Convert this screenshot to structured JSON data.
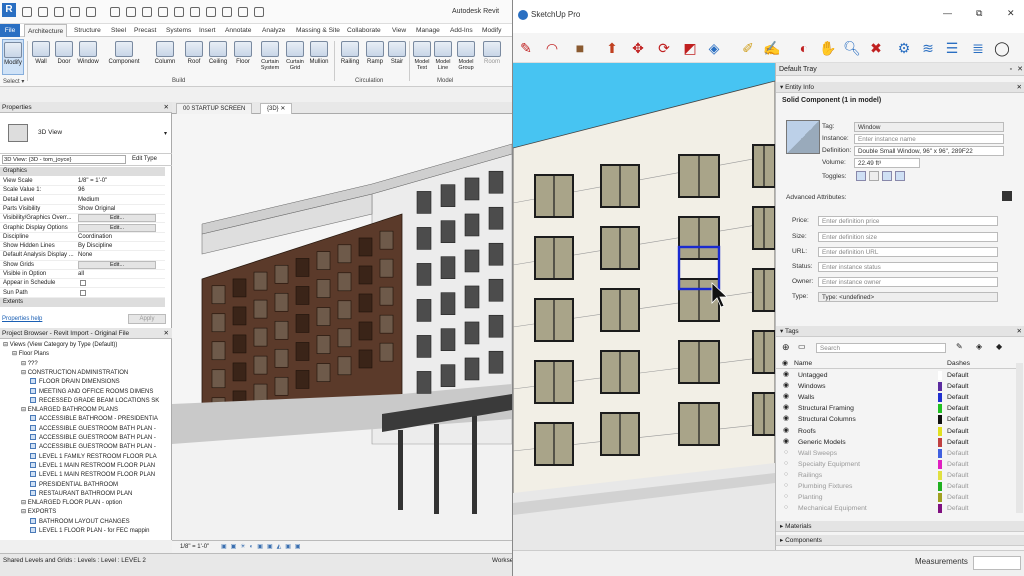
{
  "revit": {
    "title": "Autodesk Revit",
    "tabs": [
      "File",
      "Architecture",
      "Structure",
      "Steel",
      "Precast",
      "Systems",
      "Insert",
      "Annotate",
      "Analyze",
      "Massing & Site",
      "Collaborate",
      "View",
      "Manage",
      "Add-Ins",
      "Modify"
    ],
    "ribbon_tools": [
      "Modify",
      "Wall",
      "Door",
      "Window",
      "Component",
      "Column",
      "Roof",
      "Ceiling",
      "Floor",
      "Curtain System",
      "Curtain Grid",
      "Mullion",
      "Railing",
      "Ramp",
      "Stair",
      "Model Text",
      "Model Line",
      "Model Group",
      "Room"
    ],
    "ribbon_groups": {
      "select": "Select ▾",
      "build": "Build",
      "circulation": "Circulation",
      "model": "Model"
    },
    "properties": {
      "header": "Properties",
      "type_name": "3D View",
      "view_selector": "3D View: {3D - tom_joyce}",
      "edit_type": "Edit Type",
      "section_graphics": "Graphics",
      "rows": [
        {
          "k": "View Scale",
          "v": "1/8\" = 1'-0\""
        },
        {
          "k": "Scale Value    1:",
          "v": "96"
        },
        {
          "k": "Detail Level",
          "v": "Medium"
        },
        {
          "k": "Parts Visibility",
          "v": "Show Original"
        },
        {
          "k": "Visibility/Graphics Overr...",
          "v": "Edit..."
        },
        {
          "k": "Graphic Display Options",
          "v": "Edit..."
        },
        {
          "k": "Discipline",
          "v": "Coordination"
        },
        {
          "k": "Show Hidden Lines",
          "v": "By Discipline"
        },
        {
          "k": "Default Analysis Display ...",
          "v": "None"
        },
        {
          "k": "Show Grids",
          "v": "Edit..."
        },
        {
          "k": "Visible in Option",
          "v": "all"
        },
        {
          "k": "Appear in Schedule",
          "v": ""
        },
        {
          "k": "Sun Path",
          "v": ""
        }
      ],
      "section_extents": "Extents",
      "help_link": "Properties help",
      "apply": "Apply"
    },
    "browser": {
      "header": "Project Browser - Revit Import - Original File",
      "items": [
        {
          "t": "Views (View Category by Type (Default))",
          "d": 0
        },
        {
          "t": "Floor Plans",
          "d": 1
        },
        {
          "t": "???",
          "d": 2
        },
        {
          "t": "CONSTRUCTION ADMINISTRATION",
          "d": 2
        },
        {
          "t": "FLOOR DRAIN DIMENSIONS",
          "d": 3
        },
        {
          "t": "MEETING AND OFFICE ROOMS DIMENS",
          "d": 3
        },
        {
          "t": "RECESSED GRADE BEAM LOCATIONS SK",
          "d": 3
        },
        {
          "t": "ENLARGED BATHROOM PLANS",
          "d": 2
        },
        {
          "t": "ACCESSIBLE BATHROOM - PRESIDENTIA",
          "d": 3
        },
        {
          "t": "ACCESSIBLE GUESTROOM BATH PLAN -",
          "d": 3
        },
        {
          "t": "ACCESSIBLE GUESTROOM BATH PLAN -",
          "d": 3
        },
        {
          "t": "ACCESSIBLE GUESTROOM BATH PLAN -",
          "d": 3
        },
        {
          "t": "LEVEL 1 FAMILY RESTROOM FLOOR PLA",
          "d": 3
        },
        {
          "t": "LEVEL 1 MAIN RESTROOM FLOOR PLAN",
          "d": 3
        },
        {
          "t": "LEVEL 1 MAIN RESTROOM FLOOR PLAN",
          "d": 3
        },
        {
          "t": "PRESIDENTIAL BATHROOM",
          "d": 3
        },
        {
          "t": "RESTAURANT BATHROOM PLAN",
          "d": 3
        },
        {
          "t": "ENLARGED FLOOR PLAN - option",
          "d": 2
        },
        {
          "t": "EXPORTS",
          "d": 2
        },
        {
          "t": "BATHROOM LAYOUT CHANGES",
          "d": 3
        },
        {
          "t": "LEVEL 1 FLOOR PLAN - for FEC mappin",
          "d": 3
        }
      ]
    },
    "view_tabs": [
      "00 STARTUP SCREEN",
      "{3D}"
    ],
    "view_scale": "1/8\" = 1'-0\"",
    "status": "Shared Levels and Grids : Levels : Level : LEVEL 2",
    "workset": "Workse"
  },
  "sketchup": {
    "title": "SketchUp Pro",
    "tray_title": "Default Tray",
    "entity_info": {
      "header": "Entity Info",
      "heading": "Solid Component (1 in model)",
      "tag_label": "Tag:",
      "tag": "Window",
      "instance_label": "Instance:",
      "instance_ph": "Enter instance name",
      "definition_label": "Definition:",
      "definition": "Double Small Window, 96\" x 96\", 289F22",
      "volume_label": "Volume:",
      "volume": "22.49 ft³",
      "toggles_label": "Toggles:",
      "advanced": "Advanced Attributes:",
      "price_label": "Price:",
      "price_ph": "Enter definition price",
      "size_label": "Size:",
      "size_ph": "Enter definition size",
      "url_label": "URL:",
      "url_ph": "Enter definition URL",
      "status_label": "Status:",
      "status_ph": "Enter instance status",
      "owner_label": "Owner:",
      "owner_ph": "Enter instance owner",
      "type_label": "Type:",
      "type": "Type: <undefined>"
    },
    "tags": {
      "header": "Tags",
      "search_ph": "Search",
      "col_name": "Name",
      "col_dashes": "Dashes",
      "rows": [
        {
          "name": "Untagged",
          "dashes": "Default",
          "color": "#ffffff",
          "on": true
        },
        {
          "name": "Windows",
          "dashes": "Default",
          "color": "#5b2ca0",
          "on": true
        },
        {
          "name": "Walls",
          "dashes": "Default",
          "color": "#2030d0",
          "on": true
        },
        {
          "name": "Structural Framing",
          "dashes": "Default",
          "color": "#20c020",
          "on": true
        },
        {
          "name": "Structural Columns",
          "dashes": "Default",
          "color": "#101010",
          "on": true
        },
        {
          "name": "Roofs",
          "dashes": "Default",
          "color": "#e0e020",
          "on": true
        },
        {
          "name": "Generic Models",
          "dashes": "Default",
          "color": "#c04040",
          "on": true
        },
        {
          "name": "Wall Sweeps",
          "dashes": "Default",
          "color": "#4060e0",
          "on": false
        },
        {
          "name": "Specialty Equipment",
          "dashes": "Default",
          "color": "#e020c0",
          "on": false
        },
        {
          "name": "Railings",
          "dashes": "Default",
          "color": "#e0e040",
          "on": false
        },
        {
          "name": "Plumbing Fixtures",
          "dashes": "Default",
          "color": "#20b020",
          "on": false
        },
        {
          "name": "Planting",
          "dashes": "Default",
          "color": "#a0a020",
          "on": false
        },
        {
          "name": "Mechanical Equipment",
          "dashes": "Default",
          "color": "#801080",
          "on": false
        }
      ]
    },
    "materials": "Materials",
    "components": "Components",
    "measurements": "Measurements"
  }
}
